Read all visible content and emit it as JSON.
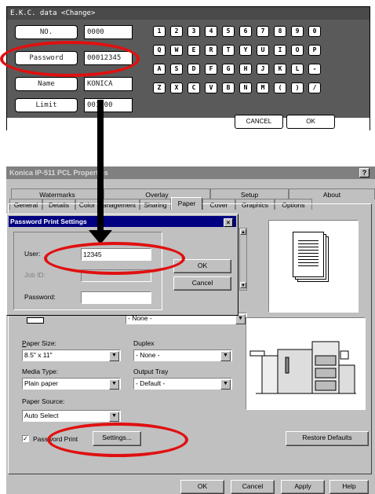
{
  "copier": {
    "title": "E.K.C. data <Change>",
    "rows": [
      {
        "button": "NO.",
        "value": "0000"
      },
      {
        "button": "Password",
        "value": "00012345"
      },
      {
        "button": "Name",
        "value": "KONICA"
      },
      {
        "button": "Limit",
        "value": "001000"
      }
    ],
    "keys": [
      [
        "1",
        "2",
        "3",
        "4",
        "5",
        "6",
        "7",
        "8",
        "9",
        "0"
      ],
      [
        "Q",
        "W",
        "E",
        "R",
        "T",
        "Y",
        "U",
        "I",
        "O",
        "P"
      ],
      [
        "A",
        "S",
        "D",
        "F",
        "G",
        "H",
        "J",
        "K",
        "L",
        "-"
      ],
      [
        "Z",
        "X",
        "C",
        "V",
        "B",
        "N",
        "M",
        "(",
        ")",
        "/"
      ]
    ],
    "cancel": "CANCEL",
    "ok": "OK"
  },
  "window": {
    "title": "Konica IP-511 PCL Properties",
    "help": "?",
    "tabs_back": [
      "Watermarks",
      "Overlay",
      "Setup",
      "About"
    ],
    "tabs_front": [
      "General",
      "Details",
      "Color Management",
      "Sharing",
      "Paper",
      "Cover",
      "Graphics",
      "Options"
    ],
    "active_tab": "Paper",
    "paper_size_label": "Paper Size:",
    "paper_size_value": "8.5\" x 11\"",
    "duplex_label": "Duplex",
    "duplex_value": "- None -",
    "media_type_label": "Media Type:",
    "media_type_value": "Plain paper",
    "output_tray_label": "Output Tray",
    "output_tray_value": "- Default -",
    "paper_source_label": "Paper Source:",
    "paper_source_value": "Auto Select",
    "hidden_combo_value": "- None -",
    "password_print_label": "Password Print",
    "password_print_checked": true,
    "settings_button": "Settings...",
    "restore_defaults": "Restore Defaults",
    "footer_buttons": [
      "OK",
      "Cancel",
      "Apply",
      "Help"
    ]
  },
  "popup": {
    "title": "Password Print Settings",
    "close": "×",
    "user_label": "User:",
    "user_value": "12345",
    "job_id_label": "Job ID:",
    "job_id_value": "",
    "password_label": "Password:",
    "password_value": "",
    "ok": "OK",
    "cancel": "Cancel"
  }
}
